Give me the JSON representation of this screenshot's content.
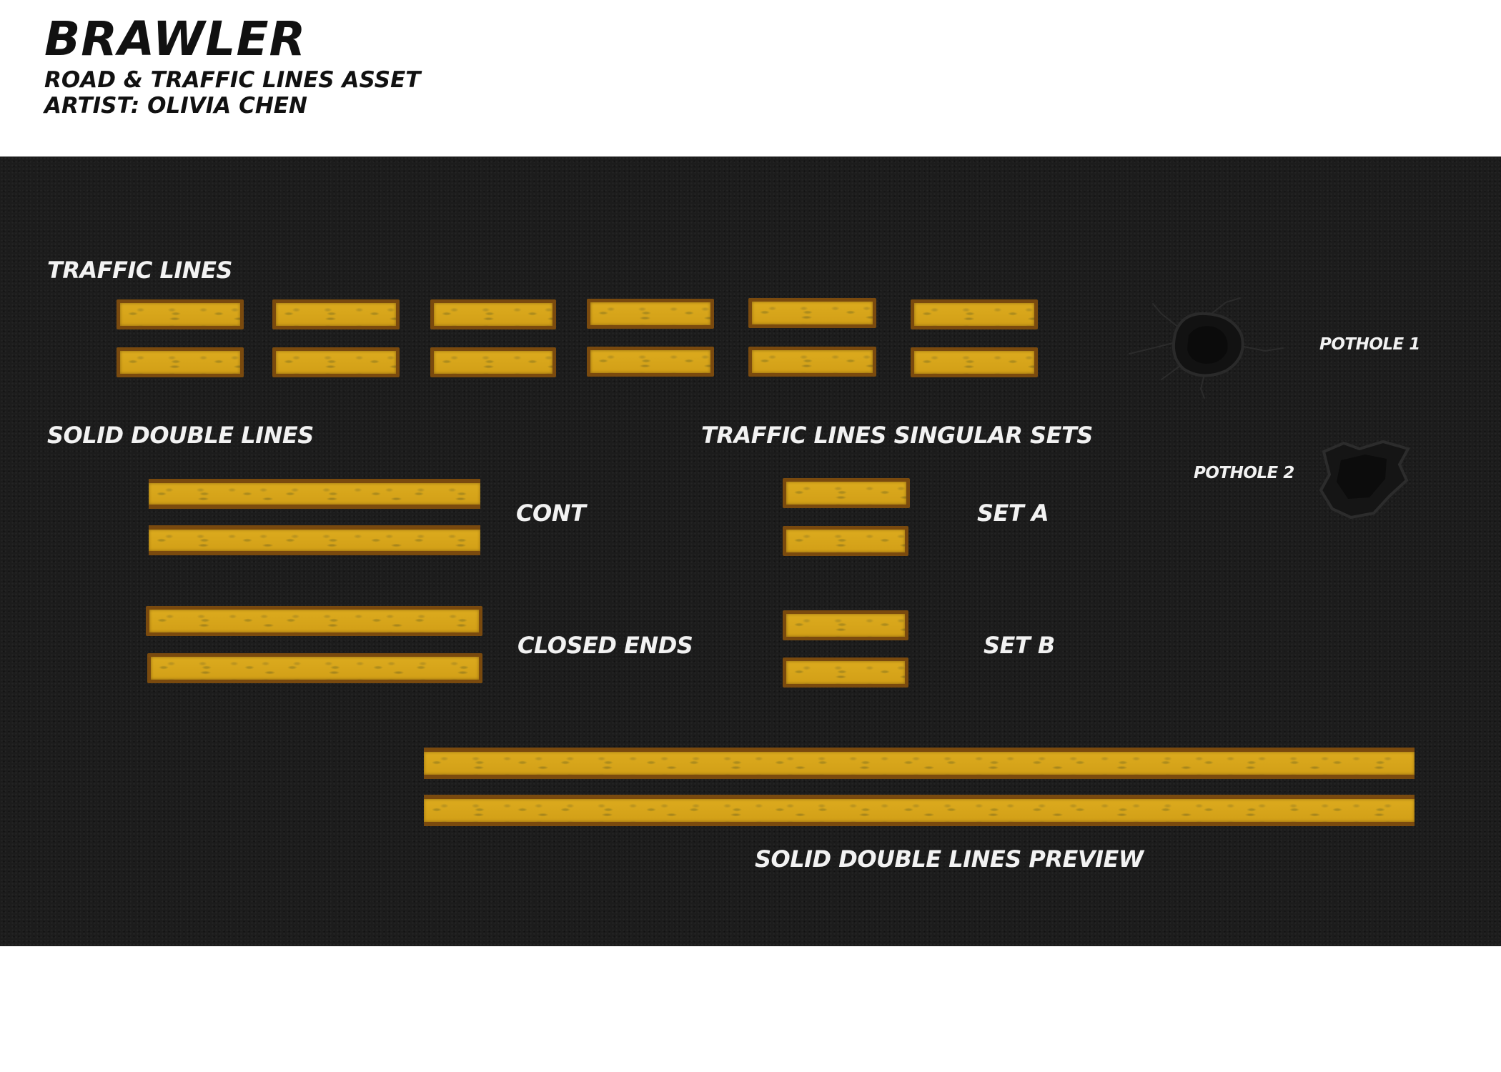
{
  "header": {
    "title": "BRAWLER",
    "subtitle": "ROAD & TRAFFIC LINES ASSET",
    "artist": "ARTIST: OLIVIA CHEN"
  },
  "sections": {
    "traffic_lines": "TRAFFIC LINES",
    "solid_double_lines": "SOLID DOUBLE LINES",
    "singular_sets": "TRAFFIC LINES SINGULAR SETS",
    "preview": "SOLID DOUBLE LINES PREVIEW"
  },
  "labels": {
    "cont": "CONT",
    "closed_ends": "CLOSED ENDS",
    "set_a": "SET A",
    "set_b": "SET B",
    "pothole_1": "POTHOLE 1",
    "pothole_2": "POTHOLE 2"
  },
  "colors": {
    "canvas_bg": "#1c1c1c",
    "line_fill": "#d6a41a",
    "line_border": "#7a4a0e",
    "label_text": "#f2f2f2"
  }
}
